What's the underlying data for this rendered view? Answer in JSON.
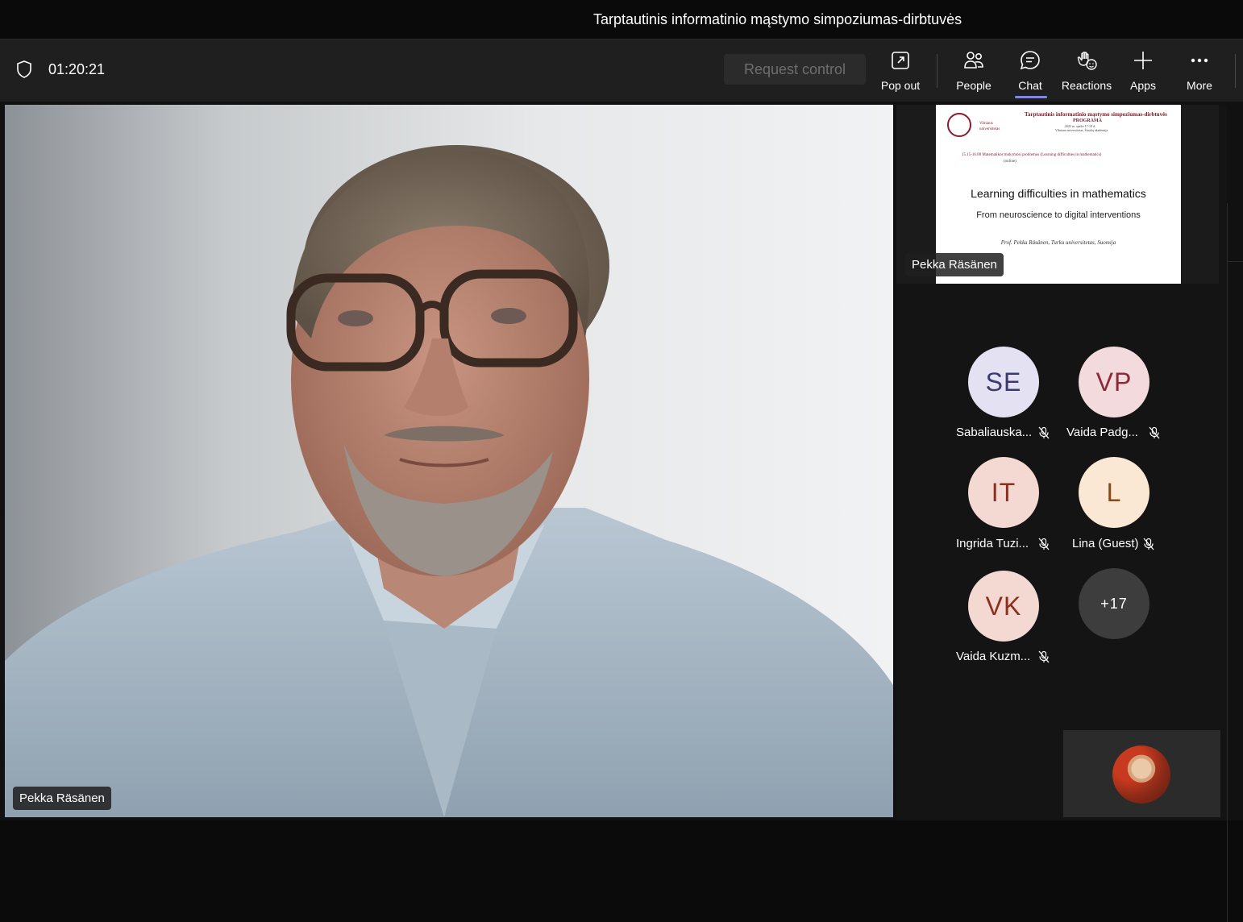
{
  "window": {
    "title": "Tarptautinis informatinio mąstymo simpoziumas-dirbtuvės"
  },
  "toolbar": {
    "timer": "01:20:21",
    "request_control": "Request control",
    "items": [
      {
        "label": "Pop out",
        "icon": "pop-out-icon"
      },
      {
        "label": "People",
        "icon": "people-icon"
      },
      {
        "label": "Chat",
        "icon": "chat-icon",
        "active": true
      },
      {
        "label": "Reactions",
        "icon": "reactions-icon"
      },
      {
        "label": "Apps",
        "icon": "plus-icon"
      },
      {
        "label": "More",
        "icon": "more-icon"
      }
    ]
  },
  "main_video": {
    "name": "Pekka Räsänen"
  },
  "shared_slide": {
    "presenter": "Pekka Räsänen",
    "header_title": "Tarptautinis informatinio mąstymo simpoziumas-dirbtuvės",
    "header_program": "PROGRAMA",
    "header_date": "2022 m. spalio 17-18 d.",
    "header_location": "Vilniaus universitetas, Šiaulių akademija",
    "logo_text_1": "Vilniaus",
    "logo_text_2": "universitetas",
    "session_line": "15.15-16.00   Matematikos mokymosi problemos (Learning difficulties in mathematics)",
    "session_line2": "(online)",
    "title": "Learning difficulties in mathematics",
    "subtitle": "From neuroscience to digital interventions",
    "author": "Prof. Pekka Räsänen, Turku universitetas, Suomija"
  },
  "participants": [
    {
      "initials": "SE",
      "name": "Sabaliauska...",
      "bg": "#e4e2f2",
      "fg": "#3b3a6e"
    },
    {
      "initials": "VP",
      "name": "Vaida Padg...",
      "bg": "#f3dadd",
      "fg": "#8b2a3a"
    },
    {
      "initials": "IT",
      "name": "Ingrida Tuzi...",
      "bg": "#f4d8d2",
      "fg": "#8c2f1e"
    },
    {
      "initials": "L",
      "name": "Lina (Guest)",
      "bg": "#fbe8d4",
      "fg": "#8a4a16"
    },
    {
      "initials": "VK",
      "name": "Vaida Kuzm...",
      "bg": "#f4d8d2",
      "fg": "#8c2f1e"
    }
  ],
  "overflow_count": "+17",
  "colors": {
    "accent": "#7f85f5",
    "toolbar_bg": "#1f1f1f"
  }
}
